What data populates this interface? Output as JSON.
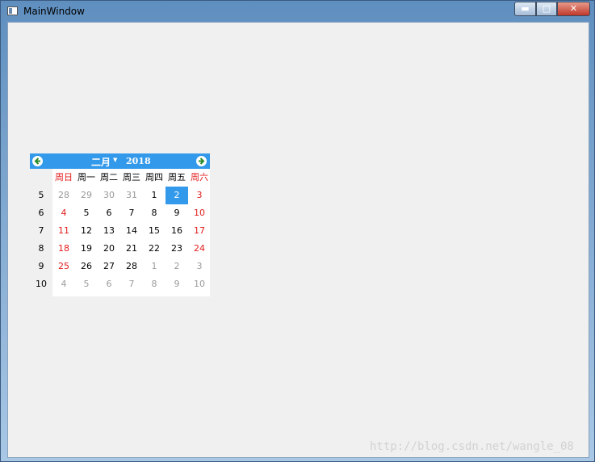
{
  "window": {
    "title": "MainWindow"
  },
  "calendar": {
    "month_label": "二月",
    "year_label": "2018",
    "day_headers": [
      {
        "label": "周日",
        "weekend": true
      },
      {
        "label": "周一",
        "weekend": false
      },
      {
        "label": "周二",
        "weekend": false
      },
      {
        "label": "周三",
        "weekend": false
      },
      {
        "label": "周四",
        "weekend": false
      },
      {
        "label": "周五",
        "weekend": false
      },
      {
        "label": "周六",
        "weekend": true
      }
    ],
    "weeks": [
      {
        "num": "5",
        "days": [
          {
            "d": "28",
            "out": true
          },
          {
            "d": "29",
            "out": true
          },
          {
            "d": "30",
            "out": true
          },
          {
            "d": "31",
            "out": true
          },
          {
            "d": "1"
          },
          {
            "d": "2",
            "selected": true
          },
          {
            "d": "3",
            "we": true
          }
        ]
      },
      {
        "num": "6",
        "days": [
          {
            "d": "4",
            "we": true
          },
          {
            "d": "5"
          },
          {
            "d": "6"
          },
          {
            "d": "7"
          },
          {
            "d": "8"
          },
          {
            "d": "9"
          },
          {
            "d": "10",
            "we": true
          }
        ]
      },
      {
        "num": "7",
        "days": [
          {
            "d": "11",
            "we": true
          },
          {
            "d": "12"
          },
          {
            "d": "13"
          },
          {
            "d": "14"
          },
          {
            "d": "15"
          },
          {
            "d": "16"
          },
          {
            "d": "17",
            "we": true
          }
        ]
      },
      {
        "num": "8",
        "days": [
          {
            "d": "18",
            "we": true
          },
          {
            "d": "19"
          },
          {
            "d": "20"
          },
          {
            "d": "21"
          },
          {
            "d": "22"
          },
          {
            "d": "23"
          },
          {
            "d": "24",
            "we": true
          }
        ]
      },
      {
        "num": "9",
        "days": [
          {
            "d": "25",
            "we": true
          },
          {
            "d": "26"
          },
          {
            "d": "27"
          },
          {
            "d": "28"
          },
          {
            "d": "1",
            "out": true
          },
          {
            "d": "2",
            "out": true
          },
          {
            "d": "3",
            "out": true
          }
        ]
      },
      {
        "num": "10",
        "days": [
          {
            "d": "4",
            "out": true
          },
          {
            "d": "5",
            "out": true
          },
          {
            "d": "6",
            "out": true
          },
          {
            "d": "7",
            "out": true
          },
          {
            "d": "8",
            "out": true
          },
          {
            "d": "9",
            "out": true
          },
          {
            "d": "10",
            "out": true
          }
        ]
      }
    ]
  },
  "watermark": "http://blog.csdn.net/wangle_08",
  "colors": {
    "accent": "#3399ea",
    "weekend": "#e21b1b",
    "out_of_month": "#9a9a9a"
  }
}
